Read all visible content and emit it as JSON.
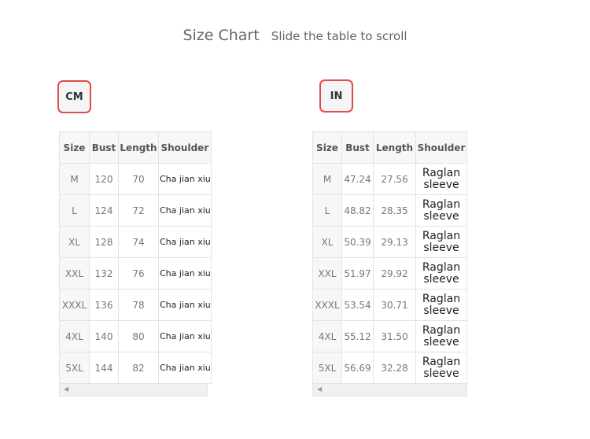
{
  "header": {
    "title": "Size Chart",
    "subtitle": "Slide the table to scroll"
  },
  "tabs": {
    "cm_label": "CM",
    "in_label": "IN"
  },
  "colors": {
    "accent_border": "#e04a4a"
  },
  "scroll_icon": "triangle-left-icon",
  "cm_table": {
    "headers": [
      "Size",
      "Bust",
      "Length",
      "Shoulder"
    ],
    "rows": [
      [
        "M",
        "120",
        "70",
        "Cha jian xiu"
      ],
      [
        "L",
        "124",
        "72",
        "Cha jian xiu"
      ],
      [
        "XL",
        "128",
        "74",
        "Cha jian xiu"
      ],
      [
        "XXL",
        "132",
        "76",
        "Cha jian xiu"
      ],
      [
        "XXXL",
        "136",
        "78",
        "Cha jian xiu"
      ],
      [
        "4XL",
        "140",
        "80",
        "Cha jian xiu"
      ],
      [
        "5XL",
        "144",
        "82",
        "Cha jian xiu"
      ]
    ]
  },
  "in_table": {
    "headers": [
      "Size",
      "Bust",
      "Length",
      "Shoulder"
    ],
    "rows": [
      [
        "M",
        "47.24",
        "27.56",
        "Raglan sleeve"
      ],
      [
        "L",
        "48.82",
        "28.35",
        "Raglan sleeve"
      ],
      [
        "XL",
        "50.39",
        "29.13",
        "Raglan sleeve"
      ],
      [
        "XXL",
        "51.97",
        "29.92",
        "Raglan sleeve"
      ],
      [
        "XXXL",
        "53.54",
        "30.71",
        "Raglan sleeve"
      ],
      [
        "4XL",
        "55.12",
        "31.50",
        "Raglan sleeve"
      ],
      [
        "5XL",
        "56.69",
        "32.28",
        "Raglan sleeve"
      ]
    ]
  }
}
